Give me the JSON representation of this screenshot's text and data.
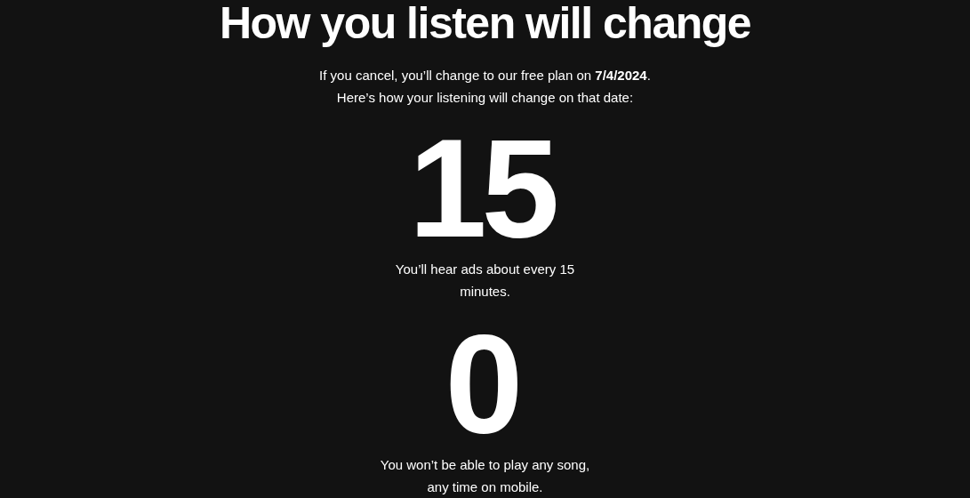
{
  "title": "How you listen will change",
  "intro": [
    "If you cancel, you’ll change to our free plan on **7/4/2024**.",
    "Here’s how your listening will change on that date:"
  ],
  "stats": [
    {
      "value": "15",
      "caption": "You’ll hear ads about every 15 minutes."
    },
    {
      "value": "0",
      "caption": "You won’t be able to play any song, any time on mobile."
    }
  ]
}
